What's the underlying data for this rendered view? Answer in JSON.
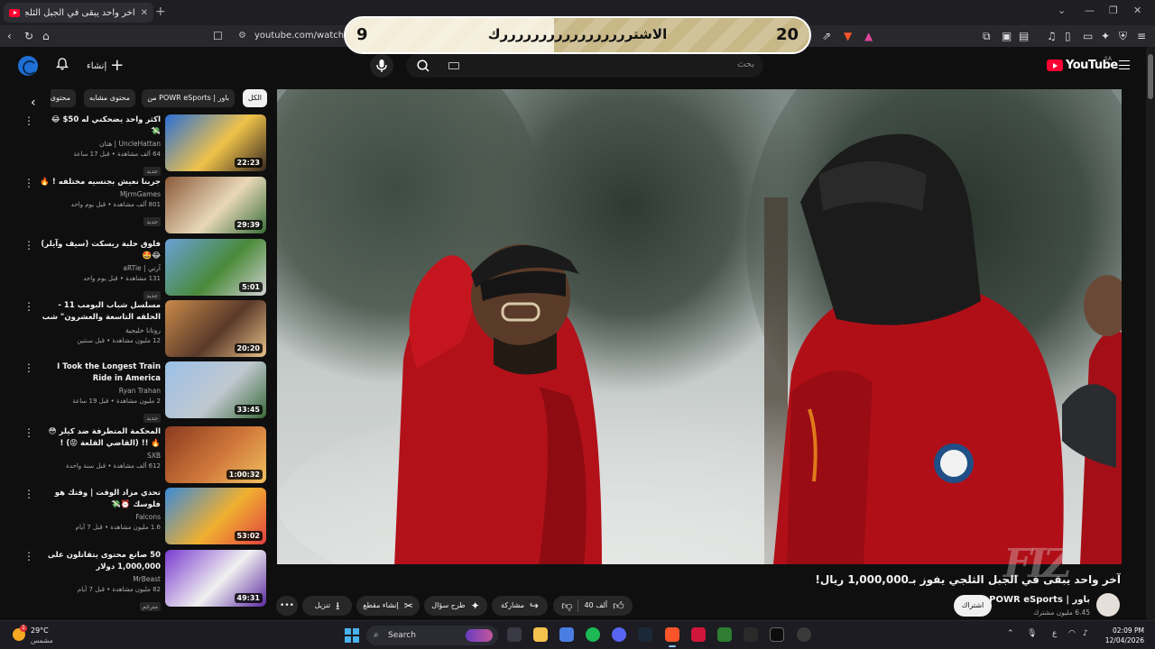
{
  "browser": {
    "tab_title": "آخر واحد يبقى في الجبل الثلجي يف",
    "tab_close": "✕",
    "new_tab": "+",
    "url": "youtube.com/watch?v=",
    "window_controls": [
      "⌄",
      "—",
      "❐",
      "✕"
    ]
  },
  "overlay": {
    "left_number": "9",
    "text": "الاشترررررررررررررررررك",
    "right_number": "20",
    "progress_fraction": 0.45
  },
  "masthead": {
    "create_label": "إنشاء",
    "search_placeholder": "بحث",
    "logo_text": "YouTube",
    "country_code": "SA"
  },
  "chips": [
    {
      "label": "الكل",
      "active": true
    },
    {
      "label": "من POWR eSports | باور",
      "active": false
    },
    {
      "label": "محتوى مشابه",
      "active": false
    },
    {
      "label": "محتوى",
      "active": false
    }
  ],
  "recommendations": [
    {
      "title": "اكثر واحد يضحكني له 50$ 😂 💸",
      "channel": "UncleHattan | هتان",
      "stats": "64 ألف مشاهدة • قبل 17 ساعة",
      "badge": "جديد",
      "duration": "22:23",
      "thumb_colors": [
        "#2a6fd6",
        "#f0c24a",
        "#3a2a20"
      ]
    },
    {
      "title": "جربنا نعيش بجنسيه مختلفه ! 🔥",
      "channel": "MjrmGames",
      "stats": "801 ألف مشاهدة • قبل يوم واحد",
      "badge": "جديد",
      "duration": "29:39",
      "thumb_colors": [
        "#8a5a3a",
        "#e9d8b8",
        "#3a6e3a"
      ]
    },
    {
      "title": "فلوق حلبة ريسكت (سيف وآيلر) 😂🤩",
      "channel": "آرتي | aRTie",
      "stats": "131 مشاهدة • قبل يوم واحد",
      "badge": "جديد",
      "duration": "5:01",
      "thumb_colors": [
        "#6aa0d8",
        "#4a8a3a",
        "#d0d0d0"
      ]
    },
    {
      "title": "مسلسل شباب البومب 11 - الحلقه التاسعة والعشرون\" شب \" 4K",
      "channel": "روتانا خليجية",
      "stats": "12 مليون مشاهدة • قبل سنتين",
      "badge": "",
      "duration": "20:20",
      "thumb_colors": [
        "#c98a4a",
        "#5a3a2a",
        "#e8c088"
      ]
    },
    {
      "title": "I Took the Longest Train Ride in America",
      "channel": "Ryan Trahan",
      "stats": "2 مليون مشاهدة • قبل 19 ساعة",
      "badge": "جديد",
      "duration": "33:45",
      "thumb_colors": [
        "#9ac0e8",
        "#c0c8d0",
        "#3a6a3a"
      ]
    },
    {
      "title": "المحكمة المتطرفة ضد كيلر 😳🔥 !! (القاضي القلعة 😡) !",
      "channel": "SXB",
      "stats": "612 ألف مشاهدة • قبل سنة واحدة",
      "badge": "",
      "duration": "1:00:32",
      "thumb_colors": [
        "#8a3a20",
        "#d0783a",
        "#f0c060"
      ]
    },
    {
      "title": "تحدي مزاد الوقت | وقتك هو فلوسك ⏰💸",
      "channel": "Falcons",
      "stats": "1.6 مليون مشاهدة • قبل 7 أيام",
      "badge": "",
      "duration": "53:02",
      "thumb_colors": [
        "#3a8ad8",
        "#f0b030",
        "#e04040"
      ]
    },
    {
      "title": "50 صانع محتوى يتقاتلون على 1,000,000 دولار",
      "channel": "MrBeast",
      "stats": "82 مليون مشاهدة • قبل 7 أيام",
      "badge": "مترجَم",
      "duration": "49:31",
      "thumb_colors": [
        "#7a3ad0",
        "#f0f0f0",
        "#5a2aa0"
      ]
    }
  ],
  "video": {
    "title": "آخر واحد يبقى في الجبل الثلجي يفوز بـ1,000,000 ريال!",
    "channel": "POWR eSports | باور",
    "subscribers": "6.45 مليون مشترك",
    "subscribe_label": "اشتراك",
    "likes": "40 ألف",
    "share_label": "مشاركة",
    "ask_label": "طرح سؤال",
    "clip_label": "إنشاء مقطع",
    "download_label": "تنزيل",
    "more_label": "•••",
    "watermark": "FIZ"
  },
  "taskbar": {
    "temperature": "29°C",
    "weather": "مشمس",
    "weather_badge": "1",
    "search_label": "Search",
    "lang": "ع",
    "time": "02:09 PM",
    "date": "12/04/2026"
  }
}
